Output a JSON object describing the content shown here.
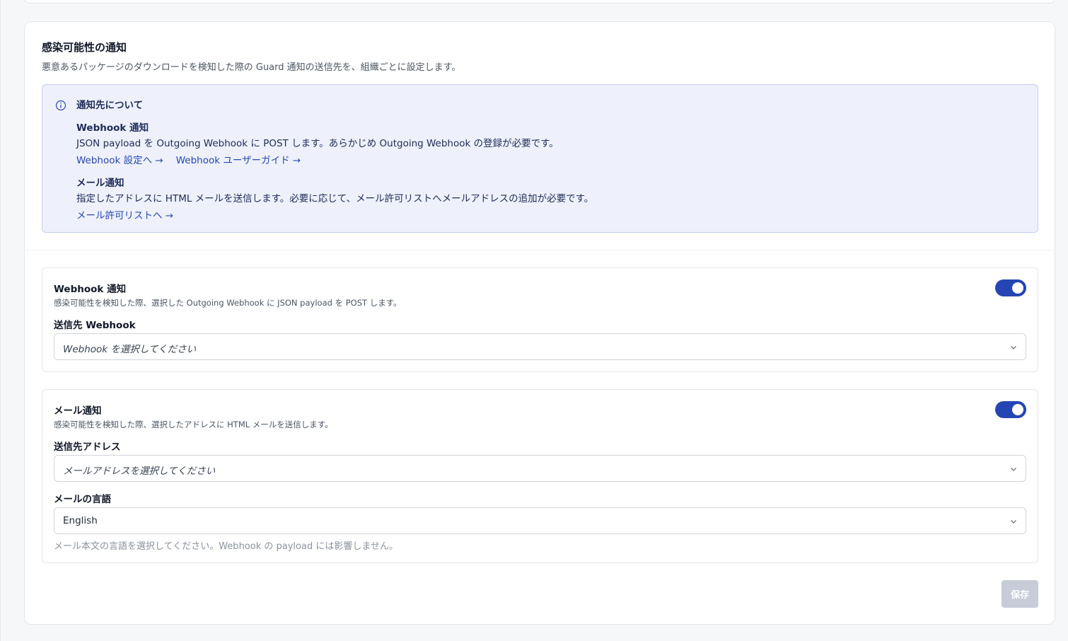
{
  "section": {
    "title": "感染可能性の通知",
    "description": "悪意あるパッケージのダウンロードを検知した際の Guard 通知の送信先を、組織ごとに設定します。"
  },
  "info": {
    "icon": "info-icon",
    "heading": "通知先について",
    "webhook": {
      "title": "Webhook 通知",
      "text": "JSON payload を Outgoing Webhook に POST します。あらかじめ Outgoing Webhook の登録が必要です。",
      "links": [
        "Webhook 設定へ →",
        "Webhook ユーザーガイド →"
      ]
    },
    "mail": {
      "title": "メール通知",
      "text": "指定したアドレスに HTML メールを送信します。必要に応じて、メール許可リストへメールアドレスの追加が必要です。",
      "link": "メール許可リストへ →"
    }
  },
  "webhook_section": {
    "title": "Webhook 通知",
    "description": "感染可能性を検知した際、選択した Outgoing Webhook に JSON payload を POST します。",
    "enabled": true,
    "field_label": "送信先 Webhook",
    "select_placeholder": "Webhook を選択してください"
  },
  "mail_section": {
    "title": "メール通知",
    "description": "感染可能性を検知した際、選択したアドレスに HTML メールを送信します。",
    "enabled": true,
    "address_label": "送信先アドレス",
    "address_placeholder": "メールアドレスを選択してください",
    "language_label": "メールの言語",
    "language_value": "English",
    "language_help": "メール本文の言語を選択してください。Webhook の payload には影響しません。"
  },
  "save_label": "保存",
  "colors": {
    "accent": "#2545b5",
    "info_bg": "#eef1fb",
    "info_border": "#c5cdf0",
    "link": "#2747b3",
    "disabled_button": "#c7ccd8"
  }
}
